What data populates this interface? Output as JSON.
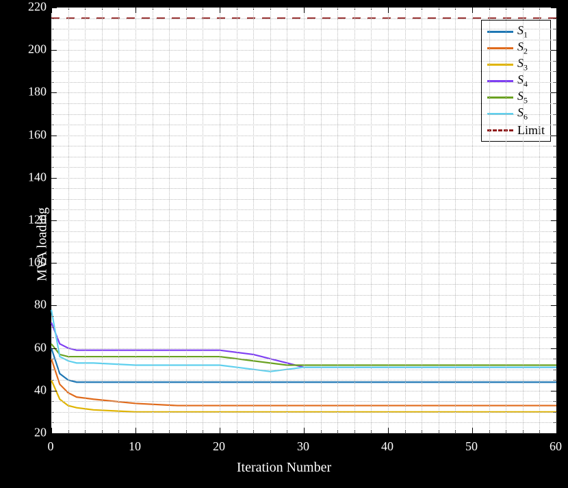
{
  "chart_data": {
    "type": "line",
    "xlabel": "Iteration Number",
    "ylabel": "MVA loading",
    "xlim": [
      0,
      60
    ],
    "ylim": [
      20,
      220
    ],
    "x_major_ticks": [
      0,
      10,
      20,
      30,
      40,
      50,
      60
    ],
    "x_minor_step": 2,
    "y_major_ticks": [
      20,
      40,
      60,
      80,
      100,
      120,
      140,
      160,
      180,
      200,
      220
    ],
    "y_minor_step": 5,
    "grid": true,
    "x": [
      0,
      1,
      2,
      3,
      5,
      10,
      15,
      20,
      22,
      24,
      26,
      28,
      30,
      35,
      40,
      50,
      60
    ],
    "series": [
      {
        "name": "S1",
        "subscript": "1",
        "color": "#1f77b4",
        "values": [
          60,
          48,
          45,
          44,
          44,
          44,
          44,
          44,
          44,
          44,
          44,
          44,
          44,
          44,
          44,
          44,
          44
        ]
      },
      {
        "name": "S2",
        "subscript": "2",
        "color": "#e06a1b",
        "values": [
          55,
          43,
          39,
          37,
          36,
          34,
          33,
          33,
          33,
          33,
          33,
          33,
          33,
          33,
          33,
          33,
          33
        ]
      },
      {
        "name": "S3",
        "subscript": "3",
        "color": "#e0b400",
        "values": [
          45,
          36,
          33,
          32,
          31,
          30,
          30,
          30,
          30,
          30,
          30,
          30,
          30,
          30,
          30,
          30,
          30
        ]
      },
      {
        "name": "S4",
        "subscript": "4",
        "color": "#7e3ff2",
        "values": [
          72,
          62,
          60,
          59,
          59,
          59,
          59,
          59,
          58,
          57,
          55,
          53,
          51,
          51,
          51,
          51,
          51
        ]
      },
      {
        "name": "S5",
        "subscript": "5",
        "color": "#6aa121",
        "values": [
          62,
          57,
          56,
          56,
          56,
          56,
          56,
          56,
          55,
          54,
          53,
          52,
          52,
          52,
          52,
          52,
          52
        ]
      },
      {
        "name": "S6",
        "subscript": "6",
        "color": "#5fd0ee",
        "values": [
          78,
          56,
          54,
          53,
          53,
          52,
          52,
          52,
          51,
          50,
          49,
          50,
          51,
          51,
          51,
          51,
          51
        ]
      }
    ],
    "limit": {
      "name": "Limit",
      "color": "#8f1a1a",
      "value": 215,
      "style": "dashed"
    }
  },
  "legend": {
    "items": [
      {
        "label": "S",
        "sub": "1",
        "color": "#1f77b4",
        "dash": false
      },
      {
        "label": "S",
        "sub": "2",
        "color": "#e06a1b",
        "dash": false
      },
      {
        "label": "S",
        "sub": "3",
        "color": "#e0b400",
        "dash": false
      },
      {
        "label": "S",
        "sub": "4",
        "color": "#7e3ff2",
        "dash": false
      },
      {
        "label": "S",
        "sub": "5",
        "color": "#6aa121",
        "dash": false
      },
      {
        "label": "S",
        "sub": "6",
        "color": "#5fd0ee",
        "dash": false
      },
      {
        "label": "Limit",
        "sub": "",
        "color": "#8f1a1a",
        "dash": true
      }
    ]
  }
}
